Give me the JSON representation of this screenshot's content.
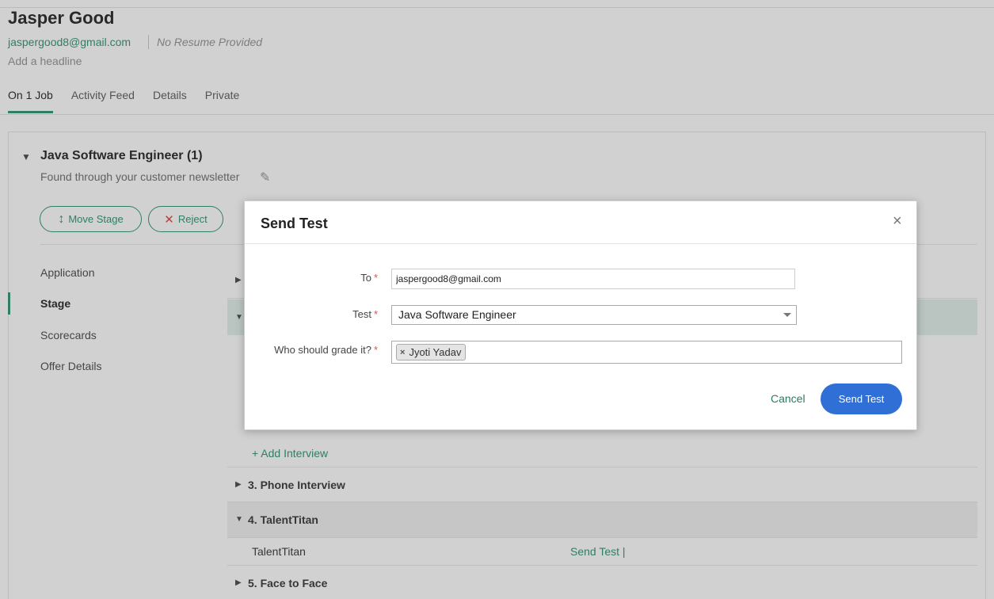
{
  "candidate": {
    "name": "Jasper Good",
    "email": "jaspergood8@gmail.com",
    "resume_status": "No Resume Provided",
    "headline_placeholder": "Add a headline"
  },
  "tabs": [
    {
      "label": "On 1 Job",
      "active": true
    },
    {
      "label": "Activity Feed"
    },
    {
      "label": "Details"
    },
    {
      "label": "Private"
    }
  ],
  "job": {
    "title": "Java Software Engineer (1)",
    "source": "Found through your customer newsletter",
    "move_stage_label": "Move Stage",
    "reject_label": "Reject"
  },
  "sidebar": [
    {
      "label": "Application"
    },
    {
      "label": "Stage",
      "active": true
    },
    {
      "label": "Scorecards"
    },
    {
      "label": "Offer Details"
    }
  ],
  "stages": {
    "add_interview": "+ Add Interview",
    "stage3": "3.  Phone Interview",
    "stage4": "4.  TalentTitan",
    "stage4_item": "TalentTitan",
    "stage4_action": "Send Test |",
    "stage5": "5.  Face to Face"
  },
  "modal": {
    "title": "Send Test",
    "to_label": "To",
    "to_value": "jaspergood8@gmail.com",
    "test_label": "Test",
    "test_value": "Java Software Engineer",
    "grader_label": "Who should grade it?",
    "grader_tag": "Jyoti Yadav",
    "cancel_label": "Cancel",
    "submit_label": "Send Test",
    "required_mark": "*",
    "close_glyph": "×"
  },
  "colors": {
    "accent_green": "#3a9b7a",
    "primary_blue": "#2f6fd6",
    "required_red": "#d9534f"
  }
}
